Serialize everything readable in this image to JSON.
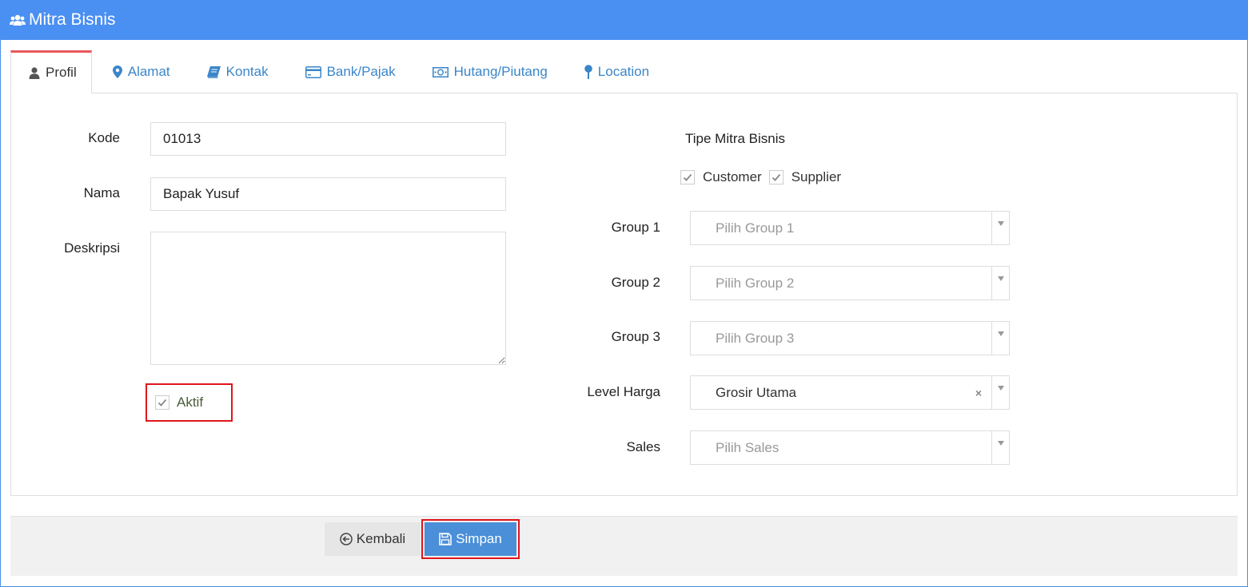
{
  "header": {
    "title": "Mitra Bisnis",
    "icon": "users-icon"
  },
  "tabs": [
    {
      "label": "Profil",
      "icon": "user-icon",
      "active": true
    },
    {
      "label": "Alamat",
      "icon": "map-marker-icon"
    },
    {
      "label": "Kontak",
      "icon": "book-icon"
    },
    {
      "label": "Bank/Pajak",
      "icon": "credit-card-icon"
    },
    {
      "label": "Hutang/Piutang",
      "icon": "money-icon"
    },
    {
      "label": "Location",
      "icon": "pin-icon"
    }
  ],
  "form": {
    "kode_label": "Kode",
    "kode_value": "01013",
    "nama_label": "Nama",
    "nama_value": "Bapak Yusuf",
    "deskripsi_label": "Deskripsi",
    "deskripsi_value": "",
    "aktif_label": "Aktif",
    "aktif_checked": true,
    "tipe_label": "Tipe Mitra Bisnis",
    "customer_label": "Customer",
    "customer_checked": true,
    "supplier_label": "Supplier",
    "supplier_checked": true,
    "group1_label": "Group 1",
    "group1_placeholder": "Pilih Group 1",
    "group2_label": "Group 2",
    "group2_placeholder": "Pilih Group 2",
    "group3_label": "Group 3",
    "group3_placeholder": "Pilih Group 3",
    "level_label": "Level Harga",
    "level_value": "Grosir Utama",
    "level_clear": "×",
    "sales_label": "Sales",
    "sales_placeholder": "Pilih Sales"
  },
  "footer": {
    "back_label": "Kembali",
    "save_label": "Simpan"
  },
  "colors": {
    "header": "#4a8ff2",
    "tab_accent": "#e9585b",
    "link": "#3a86c8",
    "save": "#4a8fd8",
    "highlight": "#e0151c"
  }
}
